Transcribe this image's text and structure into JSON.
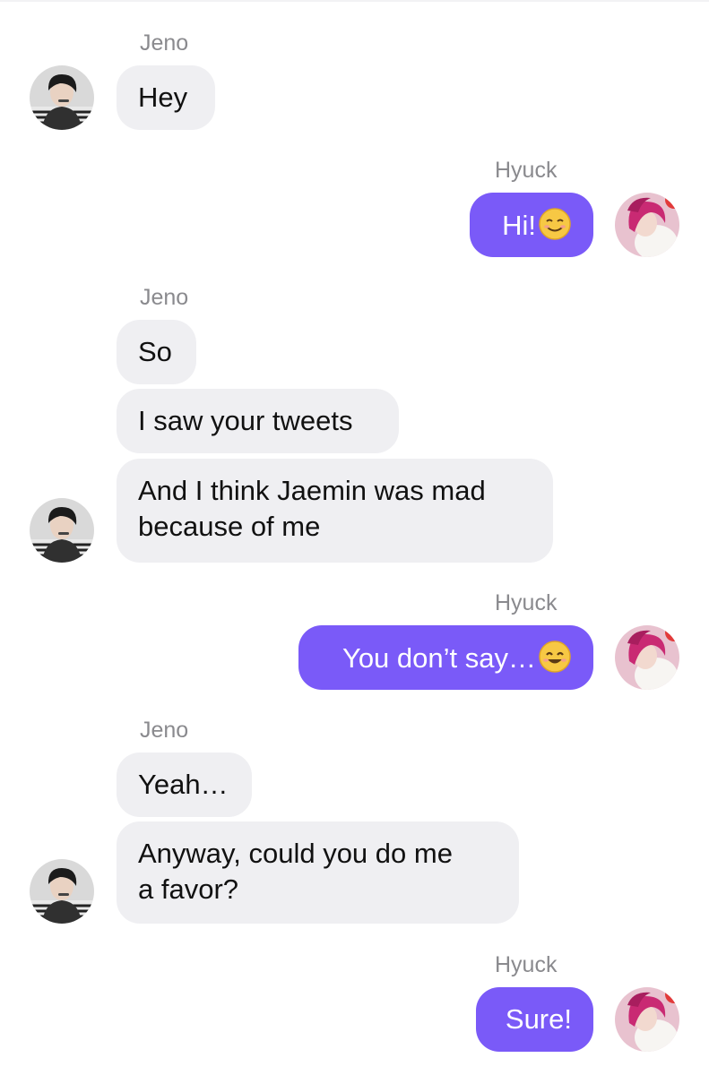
{
  "contacts": {
    "them": {
      "name": "Jeno"
    },
    "me": {
      "name": "Hyuck"
    }
  },
  "messages": [
    {
      "sender": "Jeno",
      "text": "Hey"
    },
    {
      "sender": "Hyuck",
      "text": "Hi!",
      "emoji": "smiling-face-icon"
    },
    {
      "sender": "Jeno",
      "text": "So"
    },
    {
      "sender": "Jeno",
      "text": "I saw your tweets"
    },
    {
      "sender": "Jeno",
      "text_line1": "And I think Jaemin was mad",
      "text_line2": "because of me"
    },
    {
      "sender": "Hyuck",
      "text": "You don’t say…",
      "emoji": "smiling-eyes-icon"
    },
    {
      "sender": "Jeno",
      "text": "Yeah…"
    },
    {
      "sender": "Jeno",
      "text_line1": "Anyway, could you do me",
      "text_line2": "a favor?"
    },
    {
      "sender": "Hyuck",
      "text": "Sure!"
    }
  ],
  "colors": {
    "outgoing_bubble": "#7a5af8",
    "incoming_bubble": "#efeff2",
    "name_label": "#8a8a8e"
  }
}
